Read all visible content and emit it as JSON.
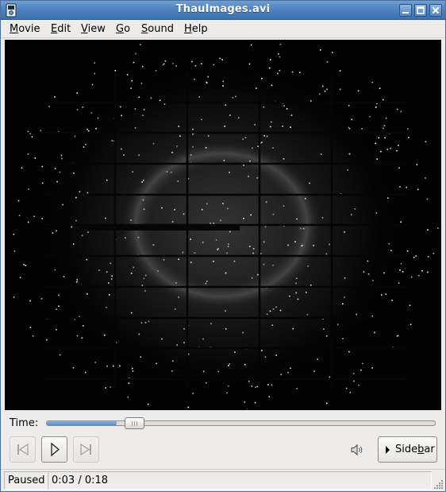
{
  "window": {
    "title": "ThauImages.avi",
    "controls": {
      "minimize": "minimize",
      "maximize": "maximize",
      "close": "close"
    }
  },
  "menubar": {
    "items": [
      {
        "mnemonic": "M",
        "rest": "ovie"
      },
      {
        "mnemonic": "E",
        "rest": "dit"
      },
      {
        "mnemonic": "V",
        "rest": "iew"
      },
      {
        "mnemonic": "G",
        "rest": "o"
      },
      {
        "mnemonic": "S",
        "rest": "ound"
      },
      {
        "mnemonic": "H",
        "rest": "elp"
      }
    ]
  },
  "video": {
    "content": "x-ray diffraction pattern frame",
    "background_color": "#020202"
  },
  "playback": {
    "time_label": "Time:",
    "progress_fraction": 0.18,
    "buttons": {
      "previous": {
        "icon": "skip-previous-icon",
        "enabled": false
      },
      "play": {
        "icon": "play-icon",
        "enabled": true
      },
      "next": {
        "icon": "skip-next-icon",
        "enabled": false
      }
    },
    "volume_icon": "speaker-volume-icon",
    "sidebar_button": {
      "pre": "Side",
      "mnemonic": "b",
      "post": "ar",
      "arrow_icon": "triangle-right-icon"
    }
  },
  "statusbar": {
    "state": "Paused",
    "time": "0:03 / 0:18"
  },
  "colors": {
    "titlebar": "#4f83c1",
    "window_bg": "#edeceb",
    "seek_fill": "#6c96cc"
  }
}
